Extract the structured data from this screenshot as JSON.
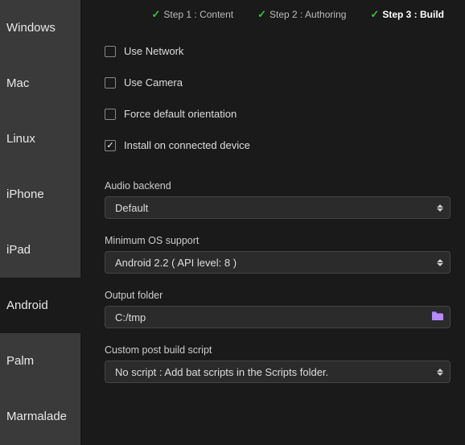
{
  "sidebar": {
    "items": [
      {
        "label": "Windows",
        "active": false
      },
      {
        "label": "Mac",
        "active": false
      },
      {
        "label": "Linux",
        "active": false
      },
      {
        "label": "iPhone",
        "active": false
      },
      {
        "label": "iPad",
        "active": false
      },
      {
        "label": "Android",
        "active": true
      },
      {
        "label": "Palm",
        "active": false
      },
      {
        "label": "Marmalade",
        "active": false
      }
    ]
  },
  "steps": [
    {
      "label": "Step 1 : Content",
      "done": true,
      "active": false
    },
    {
      "label": "Step 2 : Authoring",
      "done": true,
      "active": false
    },
    {
      "label": "Step 3 : Build",
      "done": true,
      "active": true
    }
  ],
  "checkboxes": {
    "use_network": {
      "label": "Use Network",
      "checked": false
    },
    "use_camera": {
      "label": "Use Camera",
      "checked": false
    },
    "force_orientation": {
      "label": "Force default orientation",
      "checked": false
    },
    "install_device": {
      "label": "Install on connected device",
      "checked": true
    }
  },
  "fields": {
    "audio_backend": {
      "label": "Audio backend",
      "value": "Default"
    },
    "min_os": {
      "label": "Minimum OS support",
      "value": "Android 2.2 ( API level: 8 )"
    },
    "output_folder": {
      "label": "Output folder",
      "value": "C:/tmp"
    },
    "post_build": {
      "label": "Custom post build script",
      "value": "No script : Add bat scripts in the Scripts folder."
    }
  }
}
